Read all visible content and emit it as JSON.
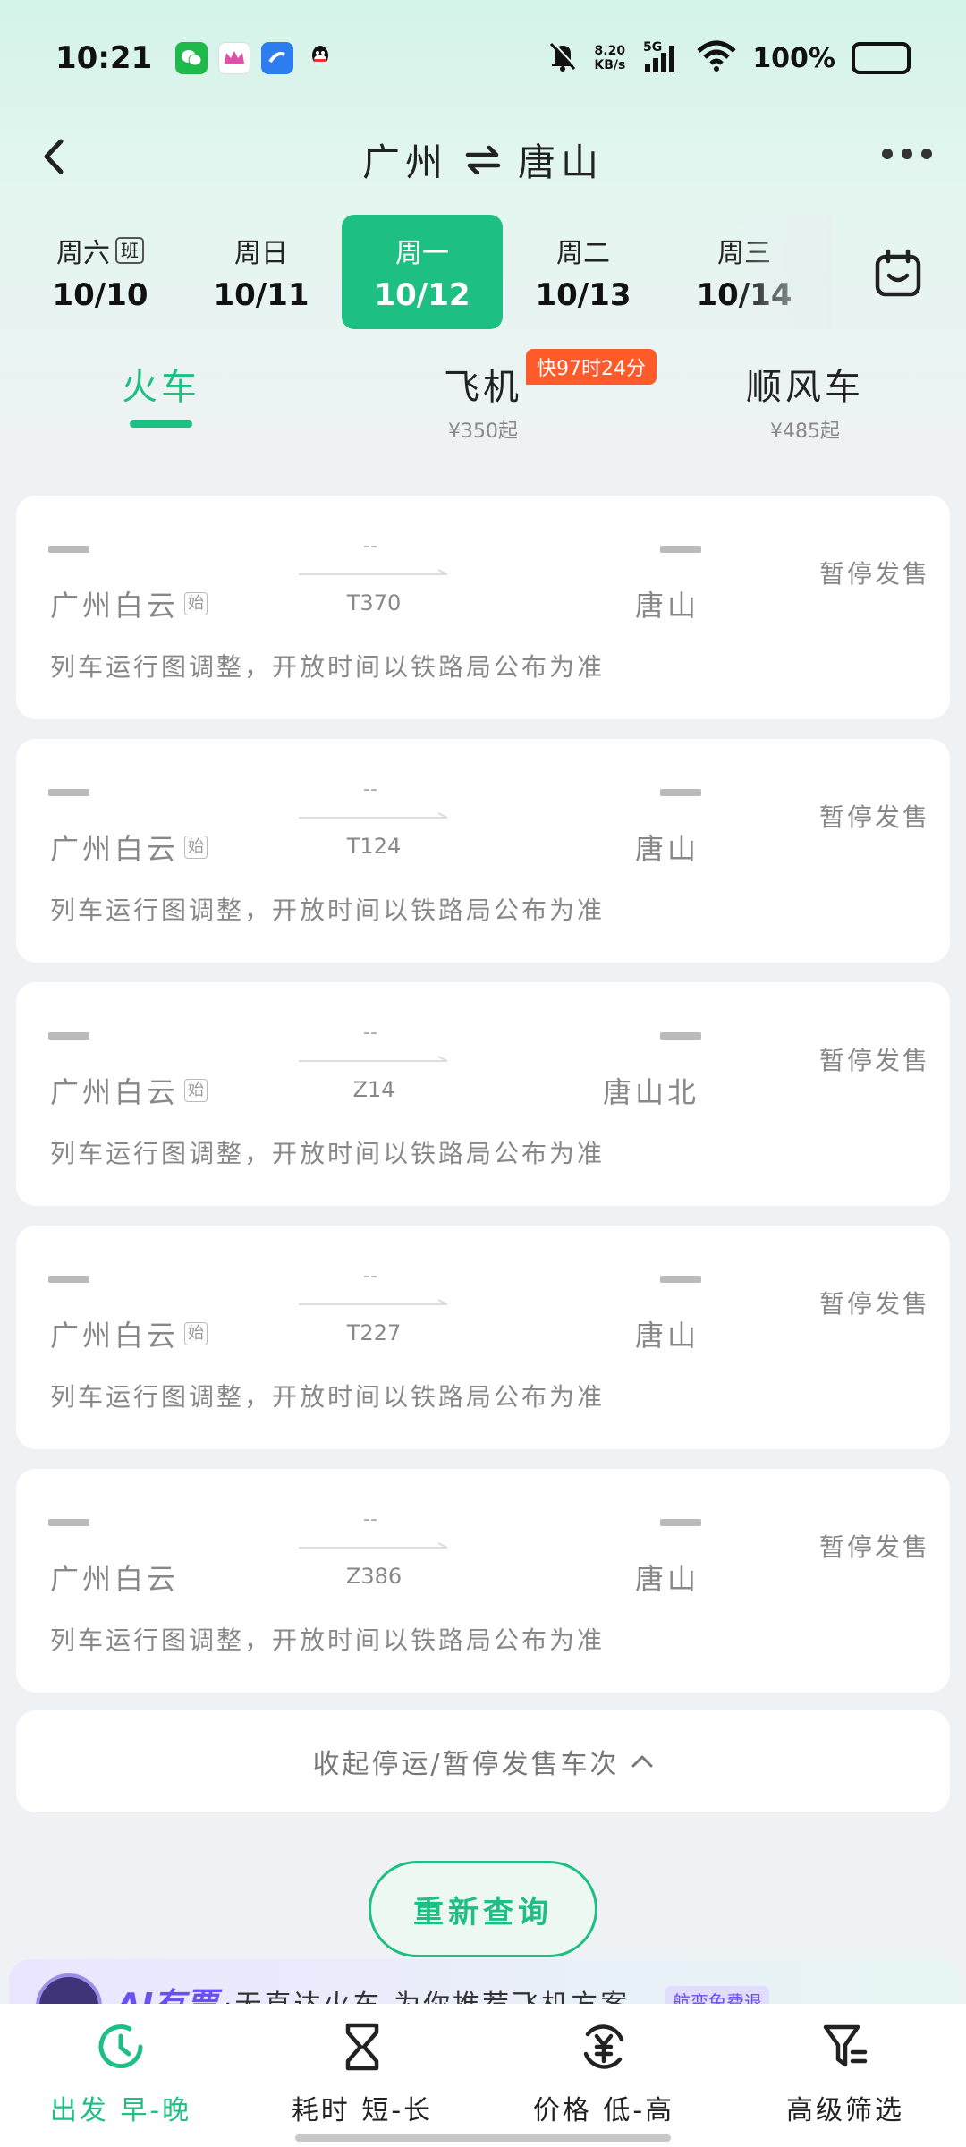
{
  "status_bar": {
    "time": "10:21",
    "speed_value": "8.20",
    "speed_unit": "KB/s",
    "network": "5G",
    "battery": "100%"
  },
  "header": {
    "from": "广州",
    "to": "唐山"
  },
  "dates": [
    {
      "week": "周六",
      "badge": "班",
      "day": "10/10",
      "active": false
    },
    {
      "week": "周日",
      "badge": "",
      "day": "10/11",
      "active": false
    },
    {
      "week": "周一",
      "badge": "",
      "day": "10/12",
      "active": true
    },
    {
      "week": "周二",
      "badge": "",
      "day": "10/13",
      "active": false
    },
    {
      "week": "周三",
      "badge": "",
      "day": "10/14",
      "active": false
    }
  ],
  "modes": {
    "train": {
      "label": "火车"
    },
    "plane": {
      "label": "飞机",
      "price": "¥350起",
      "badge": "快97时24分"
    },
    "ride": {
      "label": "顺风车",
      "price": "¥485起"
    }
  },
  "trains": [
    {
      "train_no": "T370",
      "from": "广州白云",
      "start_badge": "始",
      "to": "唐山",
      "status": "暂停发售",
      "note": "列车运行图调整，开放时间以铁路局公布为准",
      "duration": "--"
    },
    {
      "train_no": "T124",
      "from": "广州白云",
      "start_badge": "始",
      "to": "唐山",
      "status": "暂停发售",
      "note": "列车运行图调整，开放时间以铁路局公布为准",
      "duration": "--"
    },
    {
      "train_no": "Z14",
      "from": "广州白云",
      "start_badge": "始",
      "to": "唐山北",
      "status": "暂停发售",
      "note": "列车运行图调整，开放时间以铁路局公布为准",
      "duration": "--"
    },
    {
      "train_no": "T227",
      "from": "广州白云",
      "start_badge": "始",
      "to": "唐山",
      "status": "暂停发售",
      "note": "列车运行图调整，开放时间以铁路局公布为准",
      "duration": "--"
    },
    {
      "train_no": "Z386",
      "from": "广州白云",
      "start_badge": "",
      "to": "唐山",
      "status": "暂停发售",
      "note": "列车运行图调整，开放时间以铁路局公布为准",
      "duration": "--"
    }
  ],
  "collapse_label": "收起停运/暂停发售车次",
  "requery_label": "重新查询",
  "ai_banner": {
    "title": "AI有票",
    "text": "·无直达火车,为你推荐飞机方案",
    "tag": "航变免费退"
  },
  "bottom_nav": [
    {
      "label": "出发 早-晚",
      "icon": "clock-icon",
      "active": true
    },
    {
      "label": "耗时 短-长",
      "icon": "hourglass-icon",
      "active": false
    },
    {
      "label": "价格 低-高",
      "icon": "yuan-icon",
      "active": false
    },
    {
      "label": "高级筛选",
      "icon": "filter-icon",
      "active": false
    }
  ],
  "colors": {
    "accent": "#1dbf82",
    "badge": "#ff5a2a",
    "ai": "#6a4ff5"
  }
}
